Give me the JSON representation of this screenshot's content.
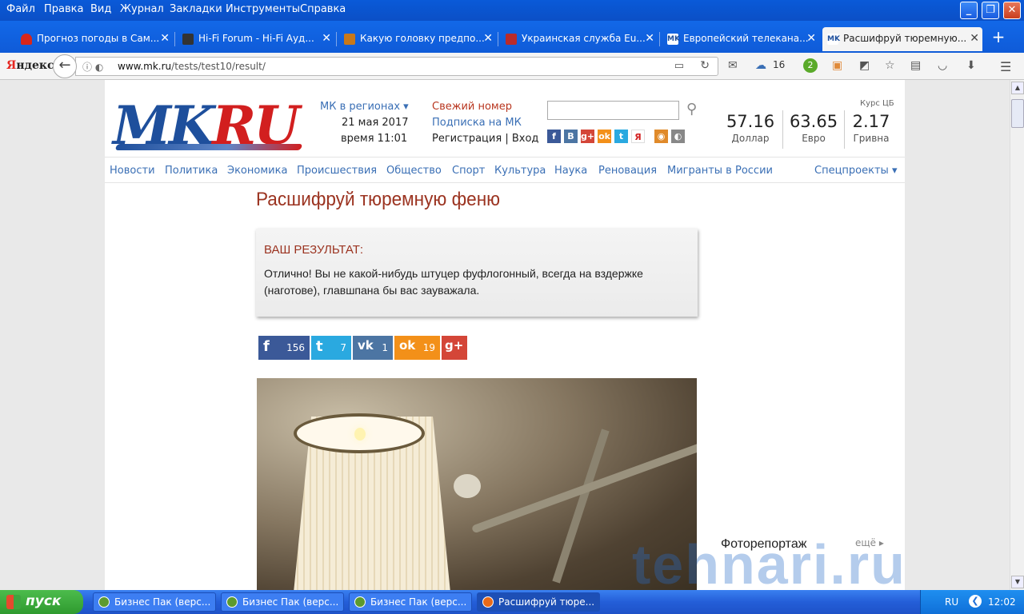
{
  "menubar": {
    "items": [
      "Файл",
      "Правка",
      "Вид",
      "Журнал",
      "Закладки",
      "Инструменты",
      "Справка"
    ]
  },
  "tabs": [
    {
      "label": "Прогноз погоды в Сам...",
      "icon": "umbrella-icon",
      "color": "#d8261b"
    },
    {
      "label": "Hi-Fi Forum - Hi-Fi Ауд...",
      "icon": "hifi-icon",
      "color": "#333333"
    },
    {
      "label": "Какую головку предпо...",
      "icon": "forum-icon",
      "color": "#c8781a"
    },
    {
      "label": "Украинская служба Eu...",
      "icon": "document-icon",
      "color": "#b92b2b"
    },
    {
      "label": "Европейский телекана...",
      "icon": "mk-icon",
      "color": "#1e4f9c"
    },
    {
      "label": "Расшифруй тюремную...",
      "icon": "mk-icon",
      "color": "#1e4f9c"
    }
  ],
  "navbar": {
    "brand": "Яндекс",
    "url_host": "www.mk.ru",
    "url_path": "/tests/test10/result/",
    "weather_temp": "16",
    "badge_count": "2"
  },
  "site": {
    "logo_mk": "MK",
    "logo_ru": "RU",
    "regions": "МК в регионах",
    "date": "21 мая 2017",
    "time": "время 11:01",
    "fresh_issue": "Свежий номер",
    "subscribe": "Подписка на МК",
    "register": "Регистрация",
    "login": "Вход",
    "separator": "|",
    "rates_title": "Курс ЦБ",
    "rates": [
      {
        "value": "57.16",
        "label": "Доллар"
      },
      {
        "value": "63.65",
        "label": "Евро"
      },
      {
        "value": "2.17",
        "label": "Гривна"
      }
    ],
    "nav": [
      "Новости",
      "Политика",
      "Экономика",
      "Происшествия",
      "Общество",
      "Спорт",
      "Культура",
      "Наука",
      "Реновация",
      "Мигранты в России"
    ],
    "special": "Спецпроекты"
  },
  "article": {
    "title": "Расшифруй тюремную феню",
    "result_label": "ВАШ РЕЗУЛЬТАТ:",
    "result_text": "Отлично! Вы не какой-нибудь штуцер фуфлогонный, всегда на вздержке (наготове), главшпана бы вас зауважала.",
    "shares": [
      {
        "network": "facebook",
        "glyph": "f",
        "count": "156",
        "color": "#3b5998"
      },
      {
        "network": "twitter",
        "glyph": "t",
        "count": "7",
        "color": "#2aa9e0"
      },
      {
        "network": "vk",
        "glyph": "vk",
        "count": "1",
        "color": "#4c75a3"
      },
      {
        "network": "odnoklassniki",
        "glyph": "ok",
        "count": "19",
        "color": "#f39019"
      },
      {
        "network": "google-plus",
        "glyph": "g+",
        "count": "",
        "color": "#d44638"
      }
    ]
  },
  "sidebar": {
    "title": "Фоторепортаж",
    "more": "ещё"
  },
  "watermark": "tehnari.ru",
  "taskbar": {
    "start": "пуск",
    "tasks": [
      "Бизнес Пак (верс...",
      "Бизнес Пак (верс...",
      "Бизнес Пак (верс...",
      "Расшифруй тюре..."
    ],
    "lang": "RU",
    "clock": "12:02"
  }
}
